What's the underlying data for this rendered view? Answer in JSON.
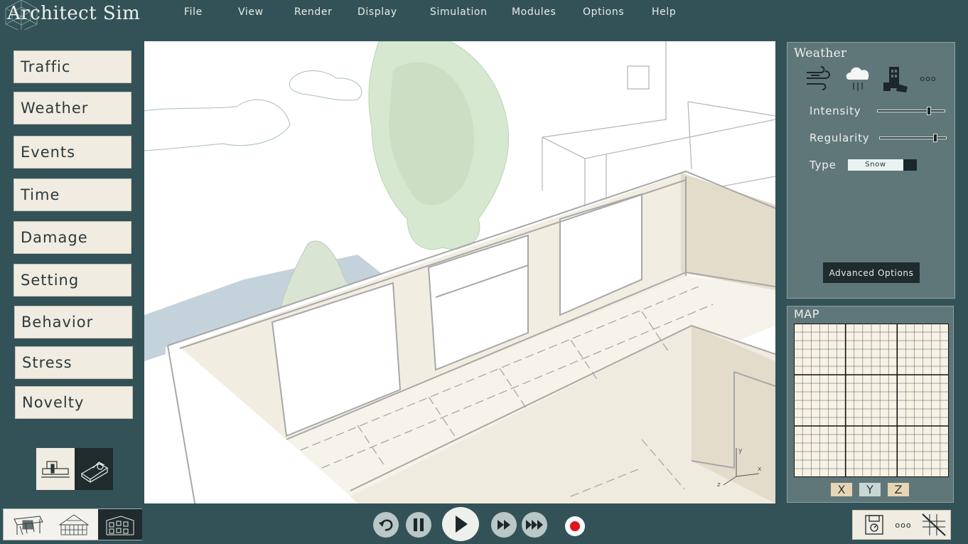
{
  "app": {
    "title": "Architect Sim"
  },
  "menu": [
    {
      "id": "file",
      "label": "File"
    },
    {
      "id": "view",
      "label": "View"
    },
    {
      "id": "render",
      "label": "Render"
    },
    {
      "id": "display",
      "label": "Display"
    },
    {
      "id": "simulation",
      "label": "Simulation"
    },
    {
      "id": "modules",
      "label": "Modules"
    },
    {
      "id": "options",
      "label": "Options"
    },
    {
      "id": "help",
      "label": "Help"
    }
  ],
  "categories": [
    {
      "id": "traffic",
      "label": "Traffic"
    },
    {
      "id": "weather",
      "label": "Weather"
    },
    {
      "id": "events",
      "label": "Events"
    },
    {
      "id": "time",
      "label": "Time"
    },
    {
      "id": "damage",
      "label": "Damage"
    },
    {
      "id": "setting",
      "label": "Setting"
    },
    {
      "id": "behavior",
      "label": "Behavior"
    },
    {
      "id": "stress",
      "label": "Stress"
    },
    {
      "id": "novelty",
      "label": "Novelty"
    }
  ],
  "mode_toggle": {
    "selected": "isometric",
    "options": [
      "section-icon",
      "isometric-icon"
    ]
  },
  "view_strip": {
    "selected": "facade",
    "options": [
      "interior-sketch-icon",
      "structure-sketch-icon",
      "facade-sketch-icon"
    ]
  },
  "weather_panel": {
    "title": "Weather",
    "icons": [
      "wind-icon",
      "snow-cloud-icon",
      "building-damage-icon",
      "more-icon"
    ],
    "more_glyph": "ooo",
    "intensity": {
      "label": "Intensity",
      "value": 0.78
    },
    "regularity": {
      "label": "Regularity",
      "value": 0.85
    },
    "type": {
      "label": "Type",
      "value": "Snow"
    },
    "advanced_label": "Advanced Options"
  },
  "map_panel": {
    "title": "MAP",
    "axes": [
      {
        "id": "x",
        "label": "X",
        "color": "#e6d6b3"
      },
      {
        "id": "y",
        "label": "Y",
        "color": "#c9d6d6"
      },
      {
        "id": "z",
        "label": "Z",
        "color": "#e6d6b3"
      }
    ]
  },
  "playback": {
    "controls": [
      "rewind-icon",
      "pause-icon",
      "play-icon",
      "fast-forward-icon",
      "faster-forward-icon",
      "record-icon"
    ],
    "record_color": "#e0141a"
  },
  "tools": {
    "items": [
      "save-disk-icon",
      "more-icon",
      "grid-measure-icon"
    ],
    "more_glyph": "ooo"
  },
  "viewport": {
    "axes": [
      "x",
      "y",
      "z"
    ]
  },
  "colors": {
    "background": "#335258",
    "panel": "#607779",
    "button": "#f1ece2",
    "tree": "#d6e8cf",
    "water": "#c4d2dc"
  }
}
